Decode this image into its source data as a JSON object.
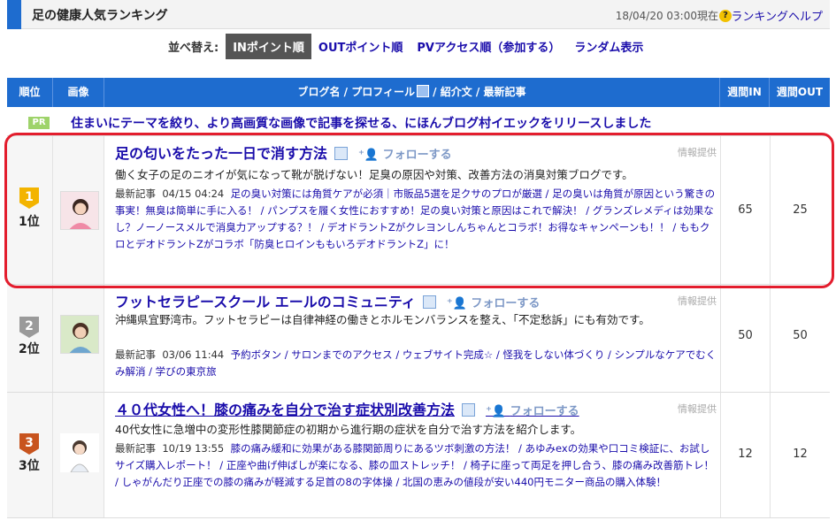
{
  "header": {
    "title": "足の健康人気ランキング",
    "timestamp": "18/04/20 03:00現在",
    "help_link": "ランキングヘルプ",
    "help_icon": "?"
  },
  "sort": {
    "label": "並べ替え:",
    "options": [
      "INポイント順",
      "OUTポイント順",
      "PVアクセス順（参加する）",
      "ランダム表示"
    ],
    "active_index": 0
  },
  "table": {
    "headers": {
      "rank": "順位",
      "image": "画像",
      "blog": "ブログ名 / プロフィール",
      "blog_tail": " / 紹介文 / 最新記事",
      "in": "週間IN",
      "out": "週間OUT"
    }
  },
  "pr": {
    "badge": "PR",
    "text": "住まいにテーマを絞り、より高画質な画像で記事を探せる、にほんブログ村イエックをリリースしました"
  },
  "rows": [
    {
      "rank_number": "1",
      "rank_label": "1位",
      "title": "足の匂いをたった一日で消す方法",
      "follow": "フォローする",
      "info": "情報提供",
      "description": "働く女子の足のニオイが気になって靴が脱げない！足臭の原因や対策、改善方法の消臭対策ブログです。",
      "recent_label": "最新記事",
      "recent_time": "04/15 04:24",
      "recent_links": "足の臭い対策には角質ケアが必須｜市販品5選を足クサのプロが厳選 / 足の臭いは角質が原因という驚きの事実！無臭は簡単に手に入る！ / パンプスを履く女性におすすめ！足の臭い対策と原因はこれで解決！ / グランズレメディは効果なし？ノーノースメルで消臭力アップする？！ / デオドラントZがクレヨンしんちゃんとコラボ！お得なキャンペーンも！！ / ももクロとデオドラントZがコラボ「防臭ヒロインももいろデオドラントZ」に！",
      "in": "65",
      "out": "25",
      "medal_color": "#f3b400"
    },
    {
      "rank_number": "2",
      "rank_label": "2位",
      "title": "フットセラピースクール エールのコミュニティ",
      "follow": "フォローする",
      "info": "情報提供",
      "description": "沖縄県宜野湾市。フットセラピーは自律神経の働きとホルモンバランスを整え、「不定愁訴」にも有効です。",
      "recent_label": "最新記事",
      "recent_time": "03/06 11:44",
      "recent_links": "予約ボタン / サロンまでのアクセス / ウェブサイト完成☆ / 怪我をしない体づくり / シンプルなケアでむくみ解消 / 学びの東京旅",
      "in": "50",
      "out": "50",
      "medal_color": "#9a9a9a"
    },
    {
      "rank_number": "3",
      "rank_label": "3位",
      "title": "４０代女性へ！膝の痛みを自分で治す症状別改善方法",
      "follow": "フォローする",
      "info": "情報提供",
      "description": "40代女性に急増中の変形性膝関節症の初期から進行期の症状を自分で治す方法を紹介します。",
      "recent_label": "最新記事",
      "recent_time": "10/19 13:55",
      "recent_links": "膝の痛み緩和に効果がある膝関節周りにあるツボ刺激の方法！ / あゆみexの効果や口コミ検証に、お試しサイズ購入レポート！ / 正座や曲げ伸ばしが楽になる、膝の皿ストレッチ！ / 椅子に座って両足を押し合う、膝の痛み改善筋トレ！ / しゃがんだり正座での膝の痛みが軽減する足首の8の字体操 / 北国の恵みの値段が安い440円モニター商品の購入体験！",
      "in": "12",
      "out": "12",
      "medal_color": "#c8541e"
    }
  ]
}
